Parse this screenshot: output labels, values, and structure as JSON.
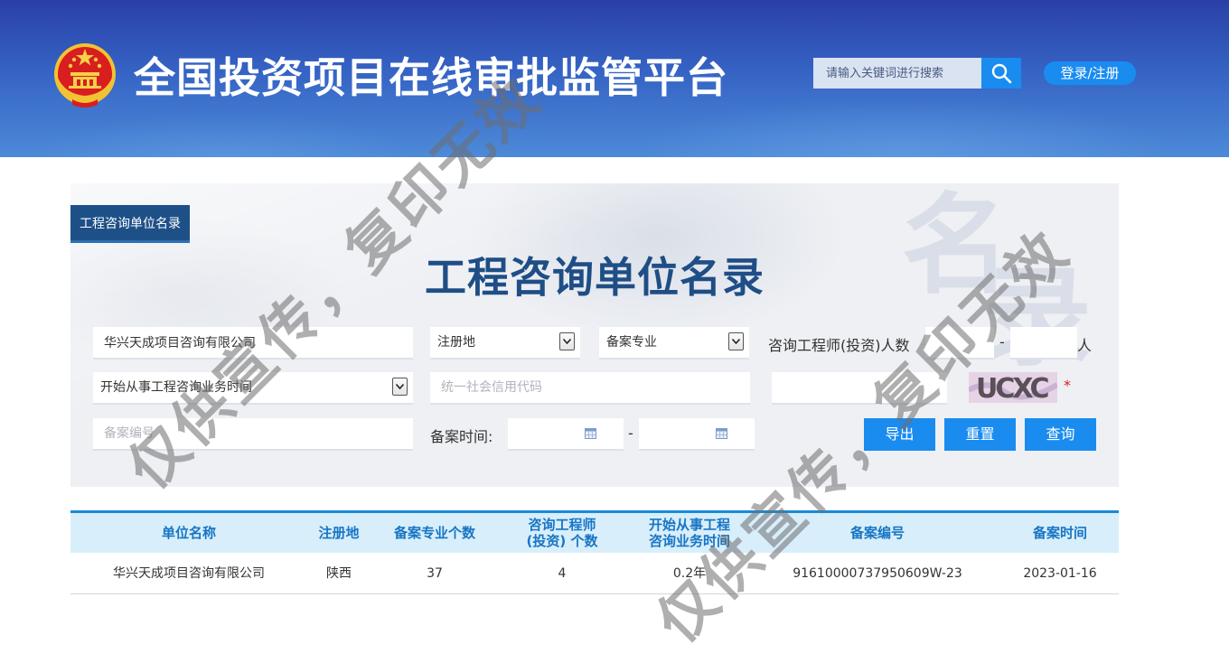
{
  "header": {
    "site_title": "全国投资项目在线审批监管平台",
    "search_placeholder": "请输入关键词进行搜索",
    "login_label": "登录/注册"
  },
  "panel": {
    "tag_label": "工程咨询单位名录",
    "title": "工程咨询单位名录",
    "unit_name_value": "华兴天成项目咨询有限公司",
    "region_select": "注册地",
    "specialty_select": "备案专业",
    "engineer_count_label": "咨询工程师(投资)人数",
    "range_dash": "-",
    "person_unit": "人",
    "start_time_select": "开始从事工程咨询业务时间",
    "credit_code_placeholder": "统一社会信用代码",
    "record_no_placeholder": "备案编号",
    "record_time_label": "备案时间:",
    "date_dash": "-",
    "captcha_text": "UCXC",
    "required_mark": "*",
    "export_label": "导出",
    "reset_label": "重置",
    "query_label": "查询"
  },
  "table": {
    "headers": [
      "单位名称",
      "注册地",
      "备案专业个数",
      "咨询工程师\n(投资) 个数",
      "开始从事工程\n咨询业务时间",
      "备案编号",
      "备案时间"
    ],
    "rows": [
      [
        "华兴天成项目咨询有限公司",
        "陕西",
        "37",
        "4",
        "0.2年",
        "91610000737950609W-23",
        "2023-01-16"
      ]
    ]
  },
  "watermark": {
    "text": "仅供宣传，复印无效"
  },
  "colors": {
    "header_blue": "#3563c4",
    "accent_blue": "#1a8cf0",
    "title_navy": "#1f4e86",
    "table_header_bg": "#d8eefb"
  }
}
